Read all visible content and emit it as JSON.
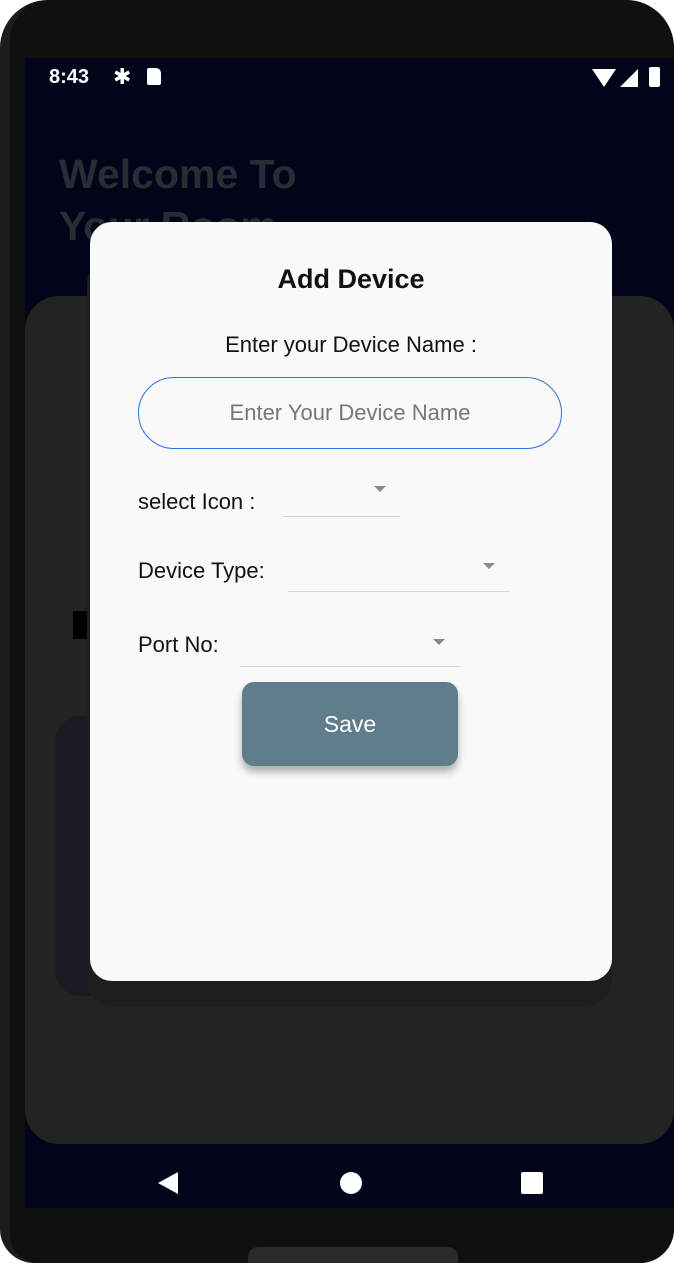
{
  "status_bar": {
    "time": "8:43",
    "icons": [
      "settings-icon",
      "sd-card-icon",
      "wifi-icon",
      "signal-icon",
      "battery-icon"
    ]
  },
  "background": {
    "title_line1": "Welcome To",
    "title_line2": "Your Room",
    "card_initial": "D"
  },
  "dialog": {
    "title": "Add Device",
    "name_label": "Enter your Device Name :",
    "name_input": {
      "value": "",
      "placeholder": "Enter Your Device Name"
    },
    "icon_label": "select Icon :",
    "device_type_label": "Device Type:",
    "port_label": "Port No:",
    "save_label": "Save"
  },
  "nav_bar": {
    "icons": [
      "back-icon",
      "home-icon",
      "recents-icon"
    ]
  },
  "colors": {
    "accent_input_border": "#2f6fd6",
    "save_button": "#607d8b",
    "screen_background": "#02041a",
    "dialog_background": "#f9f9f9"
  }
}
